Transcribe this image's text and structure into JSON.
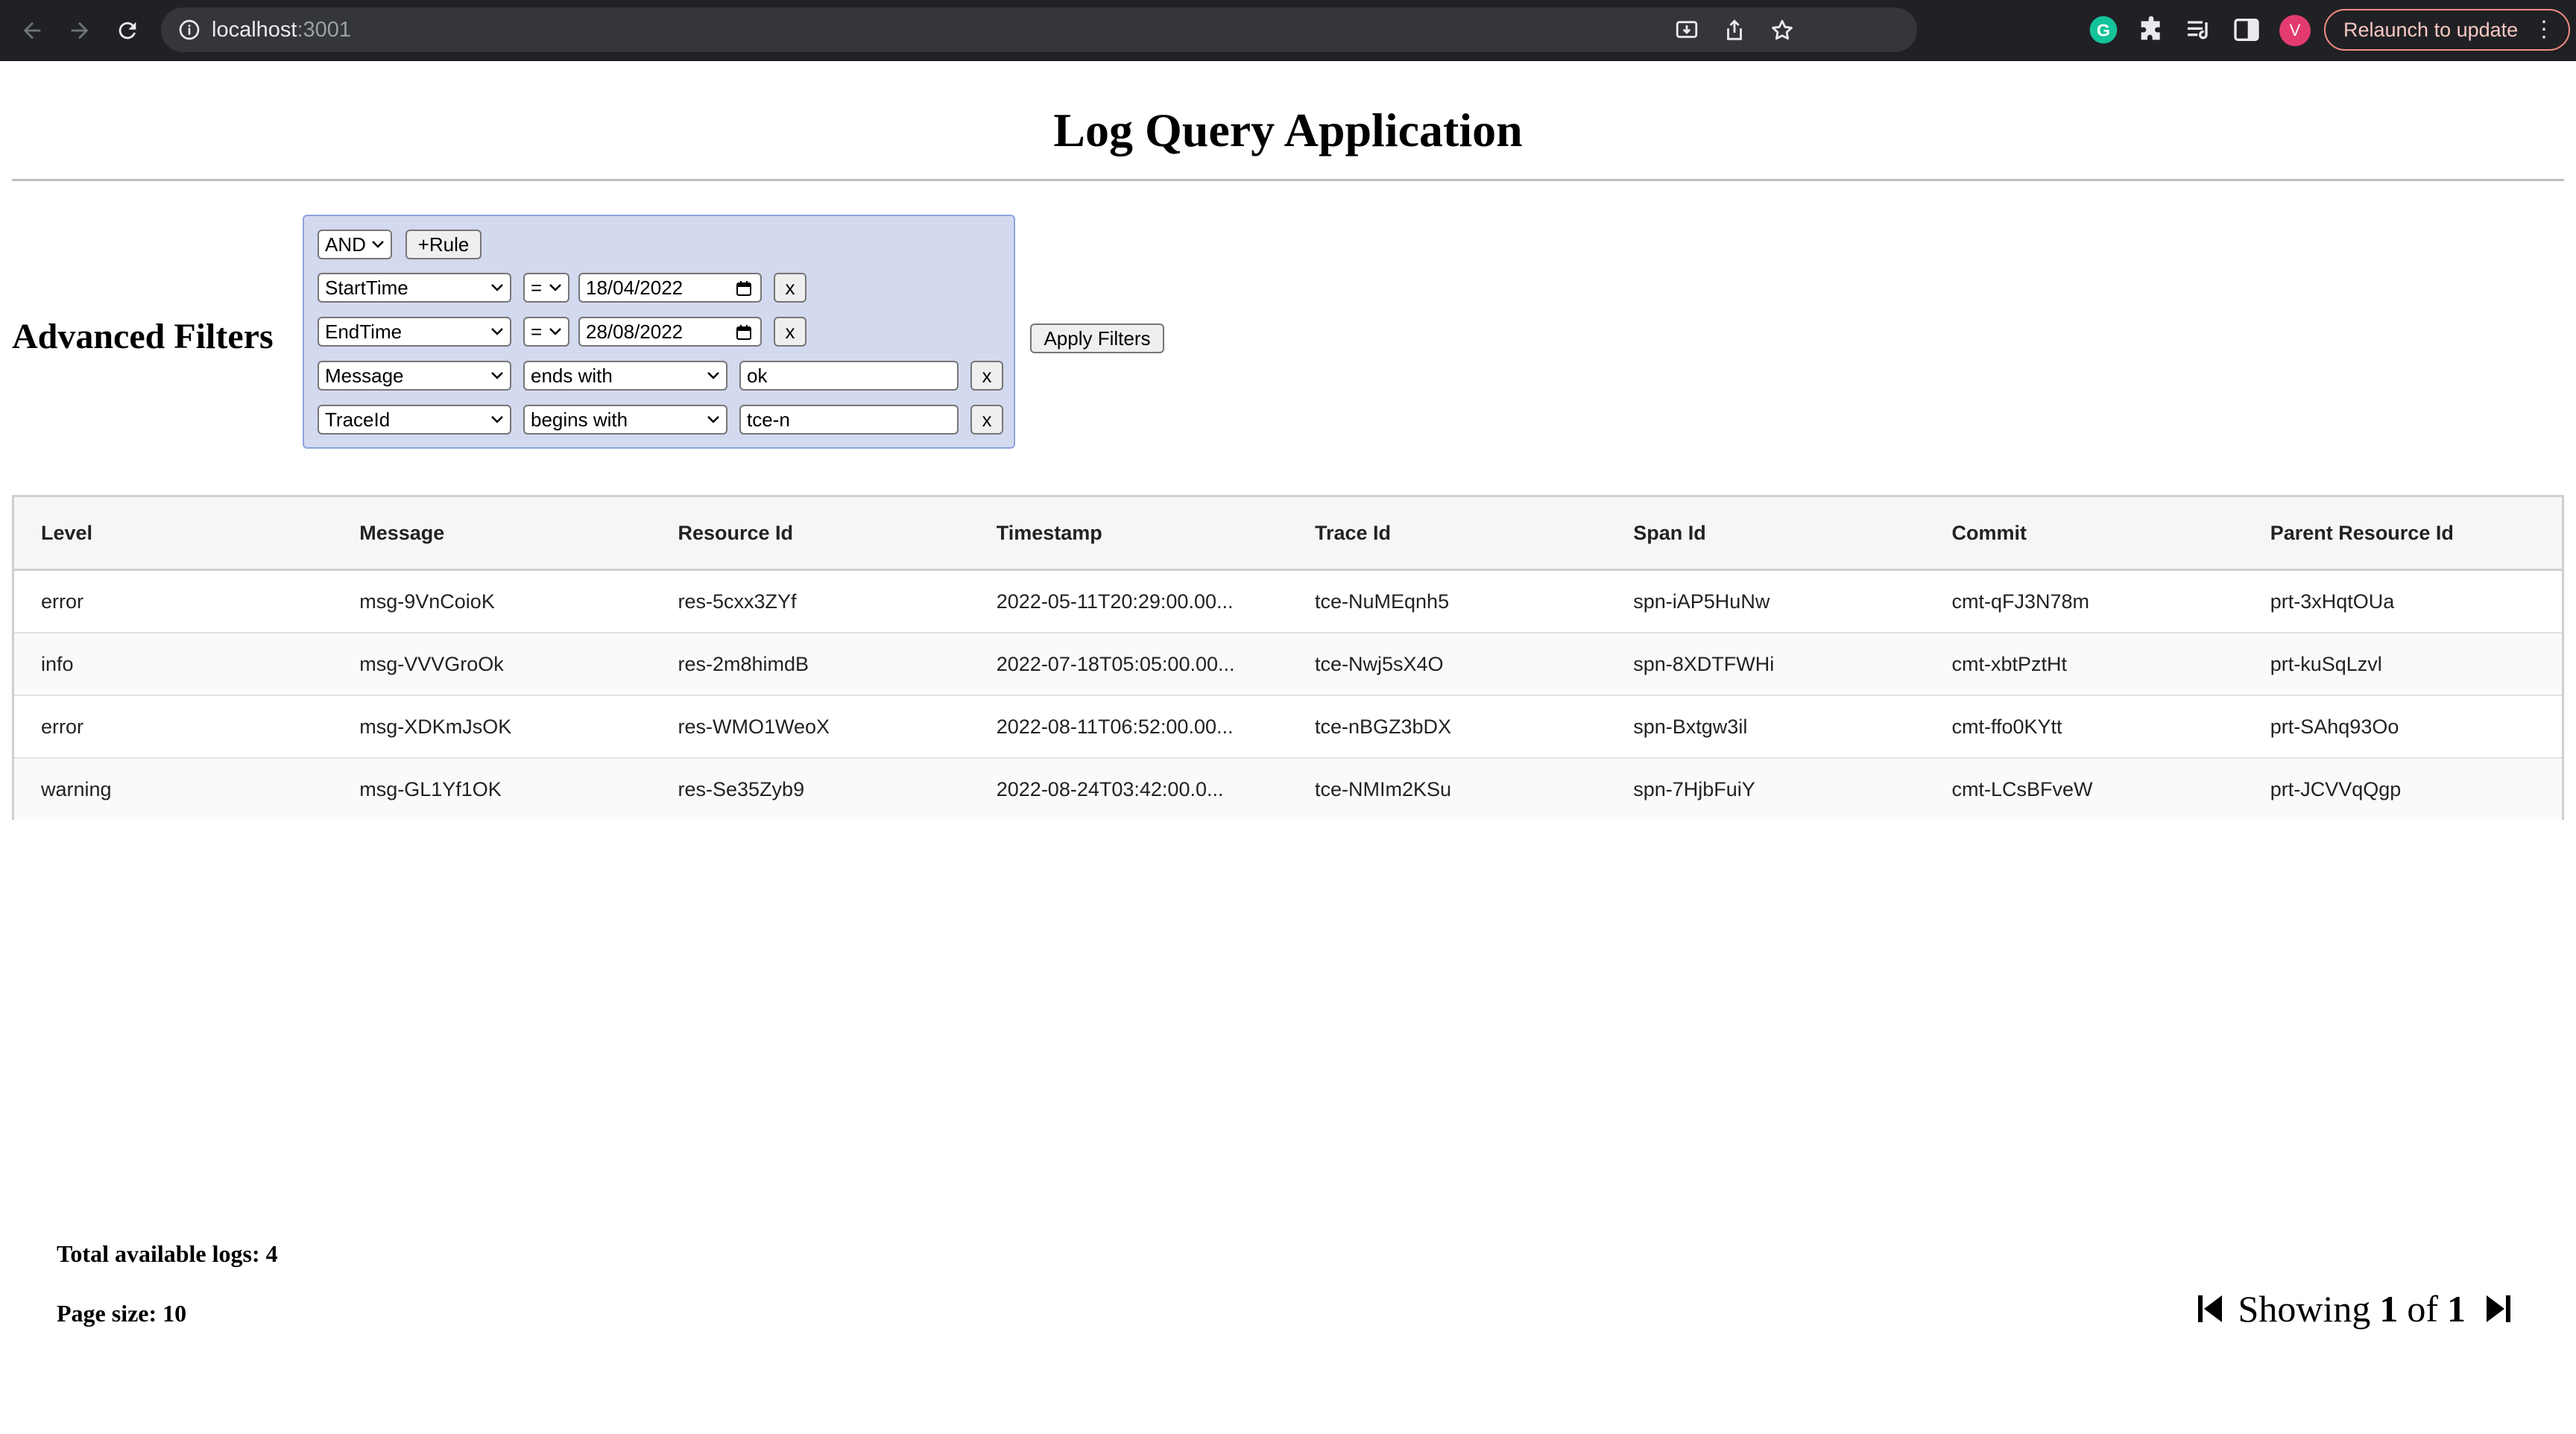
{
  "browser": {
    "url_host": "localhost",
    "url_port": ":3001",
    "avatar_letter": "V",
    "relaunch_label": "Relaunch to update"
  },
  "page": {
    "title": "Log Query Application"
  },
  "filters": {
    "heading": "Advanced Filters",
    "combinator": "AND",
    "add_rule_label": "+Rule",
    "remove_label": "x",
    "apply_label": "Apply Filters",
    "rules": [
      {
        "field": "StartTime",
        "operator": "=",
        "value": "18/04/2022"
      },
      {
        "field": "EndTime",
        "operator": "=",
        "value": "28/08/2022"
      },
      {
        "field": "Message",
        "operator": "ends with",
        "value": "ok"
      },
      {
        "field": "TraceId",
        "operator": "begins with",
        "value": "tce-n"
      }
    ]
  },
  "table": {
    "columns": [
      "Level",
      "Message",
      "Resource Id",
      "Timestamp",
      "Trace Id",
      "Span Id",
      "Commit",
      "Parent Resource Id"
    ],
    "rows": [
      [
        "error",
        "msg-9VnCoioK",
        "res-5cxx3ZYf",
        "2022-05-11T20:29:00.00...",
        "tce-NuMEqnh5",
        "spn-iAP5HuNw",
        "cmt-qFJ3N78m",
        "prt-3xHqtOUa"
      ],
      [
        "info",
        "msg-VVVGroOk",
        "res-2m8himdB",
        "2022-07-18T05:05:00.00...",
        "tce-Nwj5sX4O",
        "spn-8XDTFWHi",
        "cmt-xbtPztHt",
        "prt-kuSqLzvl"
      ],
      [
        "error",
        "msg-XDKmJsOK",
        "res-WMO1WeoX",
        "2022-08-11T06:52:00.00...",
        "tce-nBGZ3bDX",
        "spn-Bxtgw3il",
        "cmt-ffo0KYtt",
        "prt-SAhq93Oo"
      ],
      [
        "warning",
        "msg-GL1Yf1OK",
        "res-Se35Zyb9",
        "2022-08-24T03:42:00.0...",
        "tce-NMIm2KSu",
        "spn-7HjbFuiY",
        "cmt-LCsBFveW",
        "prt-JCVVqQgp"
      ]
    ]
  },
  "footer": {
    "total_label": "Total available logs: 4",
    "page_size_label": "Page size: 10",
    "showing_word": "Showing",
    "current_page": "1",
    "of_word": "of",
    "total_pages": "1"
  }
}
